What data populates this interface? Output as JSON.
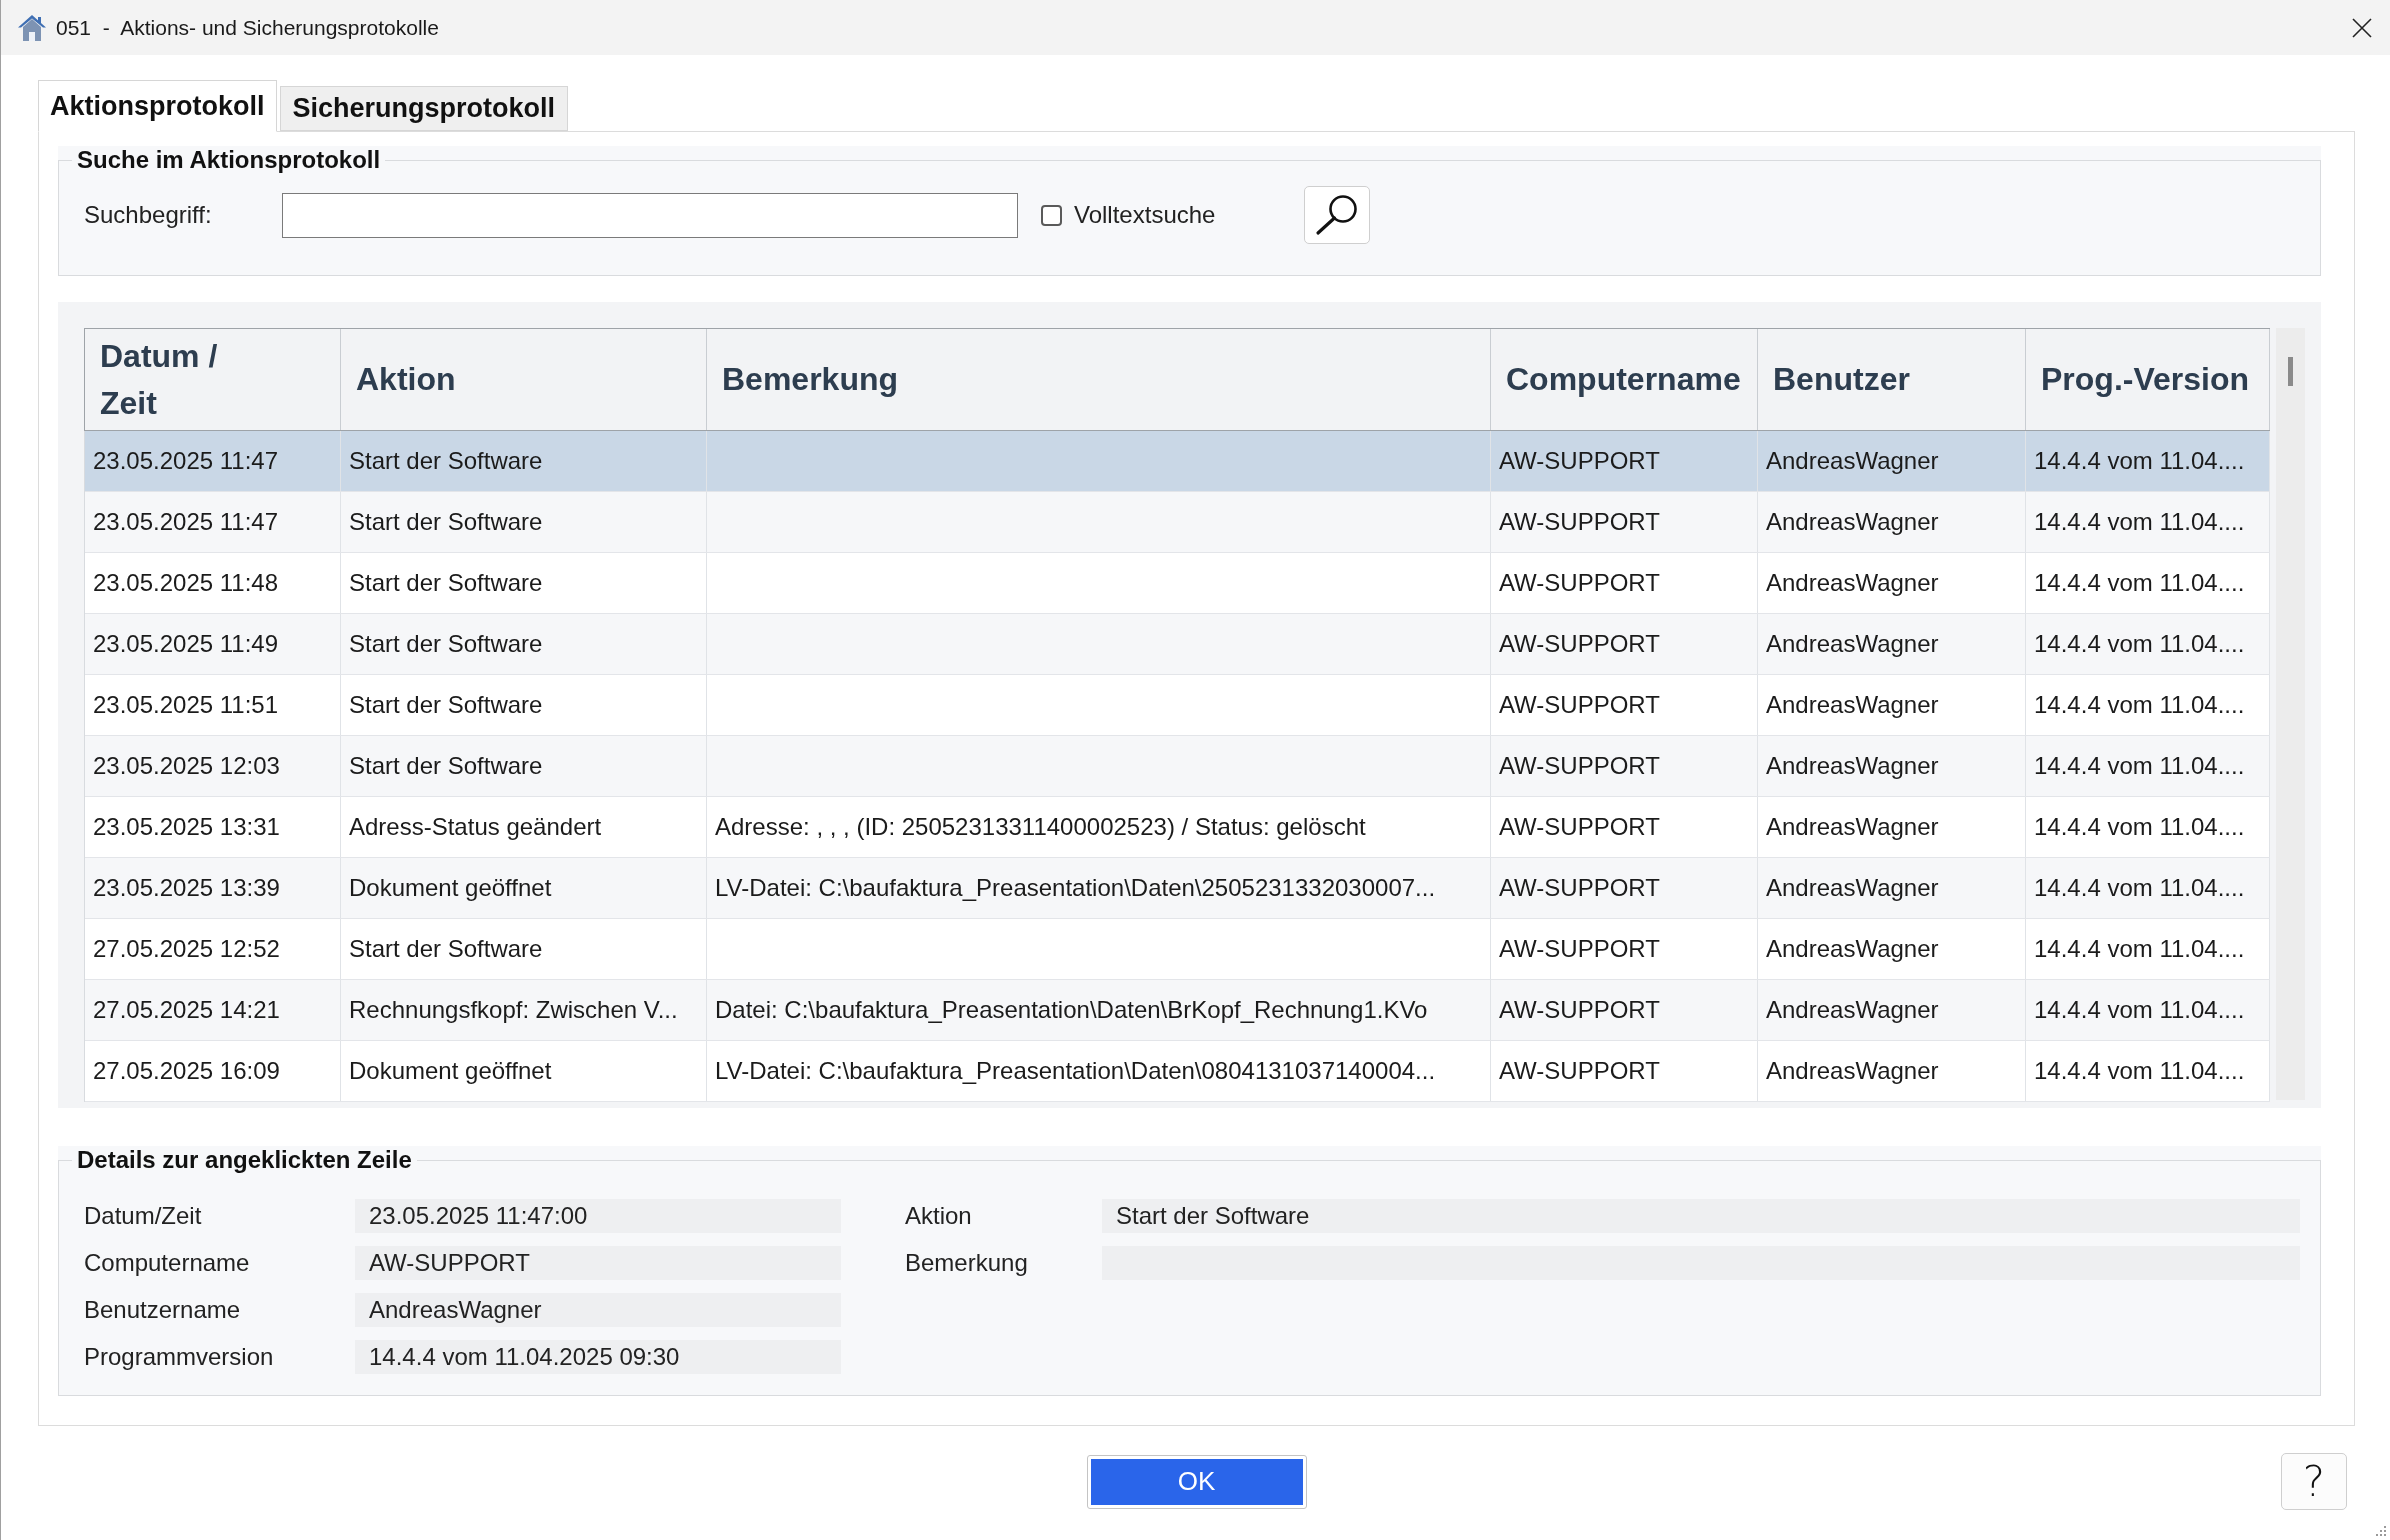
{
  "window": {
    "title": "051  -  Aktions- und Sicherungsprotokolle"
  },
  "tabs": [
    {
      "label": "Aktionsprotokoll",
      "selected": true
    },
    {
      "label": "Sicherungsprotokoll",
      "selected": false
    }
  ],
  "search": {
    "title": "Suche im Aktionsprotokoll",
    "label": "Suchbegriff:",
    "fulltext": {
      "label": "Volltextsuche",
      "checked": false
    }
  },
  "table": {
    "columns": [
      "Datum / Zeit",
      "Aktion",
      "Bemerkung",
      "Computername",
      "Benutzer",
      "Prog.-Version"
    ],
    "rows": [
      {
        "datum_zeit": "23.05.2025 11:47",
        "aktion": "Start der Software",
        "computername": "AW-SUPPORT",
        "benutzer": "AndreasWagner",
        "prog_version": "14.4.4 vom 11.04....",
        "selected": true
      },
      {
        "datum_zeit": "23.05.2025 11:47",
        "aktion": "Start der Software",
        "computername": "AW-SUPPORT",
        "benutzer": "AndreasWagner",
        "prog_version": "14.4.4 vom 11.04....",
        "selected": false
      },
      {
        "datum_zeit": "23.05.2025 11:48",
        "aktion": "Start der Software",
        "computername": "AW-SUPPORT",
        "benutzer": "AndreasWagner",
        "prog_version": "14.4.4 vom 11.04....",
        "selected": false
      },
      {
        "datum_zeit": "23.05.2025 11:49",
        "aktion": "Start der Software",
        "computername": "AW-SUPPORT",
        "benutzer": "AndreasWagner",
        "prog_version": "14.4.4 vom 11.04....",
        "selected": false
      },
      {
        "datum_zeit": "23.05.2025 11:51",
        "aktion": "Start der Software",
        "computername": "AW-SUPPORT",
        "benutzer": "AndreasWagner",
        "prog_version": "14.4.4 vom 11.04....",
        "selected": false
      },
      {
        "datum_zeit": "23.05.2025 12:03",
        "aktion": "Start der Software",
        "computername": "AW-SUPPORT",
        "benutzer": "AndreasWagner",
        "prog_version": "14.4.4 vom 11.04....",
        "selected": false
      },
      {
        "datum_zeit": "23.05.2025 13:31",
        "aktion": "Adress-Status geändert",
        "bemerkung": "Adresse: , , ,  (ID: 25052313311400002523) / Status: gelöscht",
        "computername": "AW-SUPPORT",
        "benutzer": "AndreasWagner",
        "prog_version": "14.4.4 vom 11.04....",
        "selected": false
      },
      {
        "datum_zeit": "23.05.2025 13:39",
        "aktion": "Dokument geöffnet",
        "bemerkung": "LV-Datei: C:\\baufaktura_Preasentation\\Daten\\2505231332030007...",
        "computername": "AW-SUPPORT",
        "benutzer": "AndreasWagner",
        "prog_version": "14.4.4 vom 11.04....",
        "selected": false
      },
      {
        "datum_zeit": "27.05.2025 12:52",
        "aktion": "Start der Software",
        "computername": "AW-SUPPORT",
        "benutzer": "AndreasWagner",
        "prog_version": "14.4.4 vom 11.04....",
        "selected": false
      },
      {
        "datum_zeit": "27.05.2025 14:21",
        "aktion": "Rechnungsfkopf: Zwischen V...",
        "bemerkung": "Datei: C:\\baufaktura_Preasentation\\Daten\\BrKopf_Rechnung1.KVo",
        "computername": "AW-SUPPORT",
        "benutzer": "AndreasWagner",
        "prog_version": "14.4.4 vom 11.04....",
        "selected": false
      },
      {
        "datum_zeit": "27.05.2025 16:09",
        "aktion": "Dokument geöffnet",
        "bemerkung": "LV-Datei: C:\\baufaktura_Preasentation\\Daten\\0804131037140004...",
        "computername": "AW-SUPPORT",
        "benutzer": "AndreasWagner",
        "prog_version": "14.4.4 vom 11.04....",
        "selected": false
      }
    ]
  },
  "details": {
    "title": "Details zur angeklickten Zeile",
    "left": [
      {
        "label": "Datum/Zeit",
        "value": "23.05.2025 11:47:00"
      },
      {
        "label": "Computername",
        "value": "AW-SUPPORT"
      },
      {
        "label": "Benutzername",
        "value": "AndreasWagner"
      },
      {
        "label": "Programmversion",
        "value": "14.4.4 vom 11.04.2025 09:30"
      }
    ],
    "right": [
      {
        "label": "Aktion",
        "value": "Start der Software"
      },
      {
        "label": "Bemerkung"
      }
    ]
  },
  "buttons": {
    "ok": "OK",
    "help": "?"
  }
}
